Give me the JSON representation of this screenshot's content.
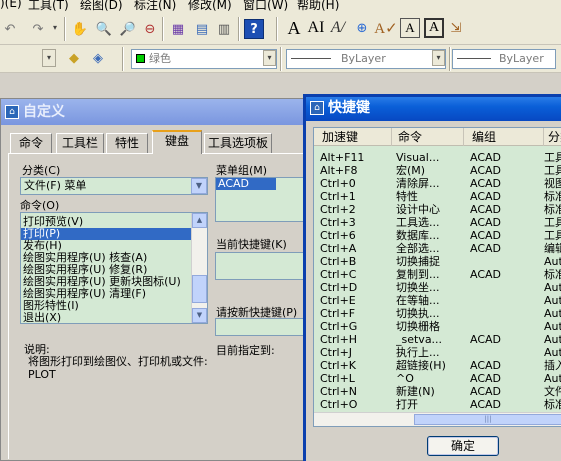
{
  "menubar": {
    "items": [
      ")(E)",
      "工具(T)",
      "绘图(D)",
      "标注(N)",
      "修改(M)",
      "窗口(W)",
      "帮助(H)"
    ]
  },
  "toolbar2": {
    "color_combo": "绿色",
    "linetype_combo": "ByLayer",
    "lineweight_combo": "ByLayer"
  },
  "customize_dialog": {
    "title": "自定义",
    "tabs": [
      "命令",
      "工具栏",
      "特性",
      "键盘",
      "工具选项板"
    ],
    "active_tab": "键盘",
    "category_label": "分类(C)",
    "category_value": "文件(F) 菜单",
    "commands_label": "命令(O)",
    "commands": [
      "打印预览(V)",
      "打印(P)",
      "发布(H)",
      "绘图实用程序(U) 核查(A)",
      "绘图实用程序(U) 修复(R)",
      "绘图实用程序(U) 更新块图标(U)",
      "绘图实用程序(U) 清理(F)",
      "图形特性(I)",
      "退出(X)"
    ],
    "selected_command": "打印(P)",
    "menu_group_label": "菜单组(M)",
    "menu_group_value": "ACAD",
    "current_keys_label": "当前快捷键(K)",
    "new_key_label": "请按新快捷键(P)",
    "assigned_to_label": "目前指定到:",
    "description_label": "说明:",
    "description_text": "将图形打印到绘图仪、打印机或文件:  PLOT"
  },
  "shortcut_dialog": {
    "title": "快捷键",
    "columns": [
      "加速键",
      "命令",
      "编组",
      "分类"
    ],
    "rows": [
      {
        "key": "Alt+F11",
        "command": "Visual...",
        "group": "ACAD",
        "category": "工具"
      },
      {
        "key": "Alt+F8",
        "command": "宏(M)",
        "group": "ACAD",
        "category": "工具"
      },
      {
        "key": "Ctrl+0",
        "command": "清除屏...",
        "group": "ACAD",
        "category": "视图"
      },
      {
        "key": "Ctrl+1",
        "command": "特性",
        "group": "ACAD",
        "category": "标准"
      },
      {
        "key": "Ctrl+2",
        "command": "设计中心",
        "group": "ACAD",
        "category": "标准"
      },
      {
        "key": "Ctrl+3",
        "command": "工具选...",
        "group": "ACAD",
        "category": "工具"
      },
      {
        "key": "Ctrl+6",
        "command": "数据库...",
        "group": "ACAD",
        "category": "工具"
      },
      {
        "key": "Ctrl+A",
        "command": "全部选...",
        "group": "ACAD",
        "category": "编辑"
      },
      {
        "key": "Ctrl+B",
        "command": "切换捕捉",
        "group": "",
        "category": "Aut"
      },
      {
        "key": "Ctrl+C",
        "command": "复制到...",
        "group": "ACAD",
        "category": "标准"
      },
      {
        "key": "Ctrl+D",
        "command": "切换坐...",
        "group": "",
        "category": "Aut"
      },
      {
        "key": "Ctrl+E",
        "command": "在等轴...",
        "group": "",
        "category": "Aut"
      },
      {
        "key": "Ctrl+F",
        "command": "切换执...",
        "group": "",
        "category": "Aut"
      },
      {
        "key": "Ctrl+G",
        "command": "切换栅格",
        "group": "",
        "category": "Aut"
      },
      {
        "key": "Ctrl+H",
        "command": "_setva...",
        "group": "ACAD",
        "category": "Aut"
      },
      {
        "key": "Ctrl+J",
        "command": "执行上...",
        "group": "",
        "category": "Aut"
      },
      {
        "key": "Ctrl+K",
        "command": "超链接(H)",
        "group": "ACAD",
        "category": "插入"
      },
      {
        "key": "Ctrl+L",
        "command": "^O",
        "group": "ACAD",
        "category": "Aut"
      },
      {
        "key": "Ctrl+N",
        "command": "新建(N)",
        "group": "ACAD",
        "category": "文件"
      },
      {
        "key": "Ctrl+O",
        "command": "打开",
        "group": "ACAD",
        "category": "标准"
      }
    ],
    "ok_label": "确定"
  },
  "colors": {
    "title_active": "#0a5fd8",
    "title_inactive": "#7a96df",
    "list_bg": "#d4e9d4",
    "selection": "#316ac5"
  }
}
